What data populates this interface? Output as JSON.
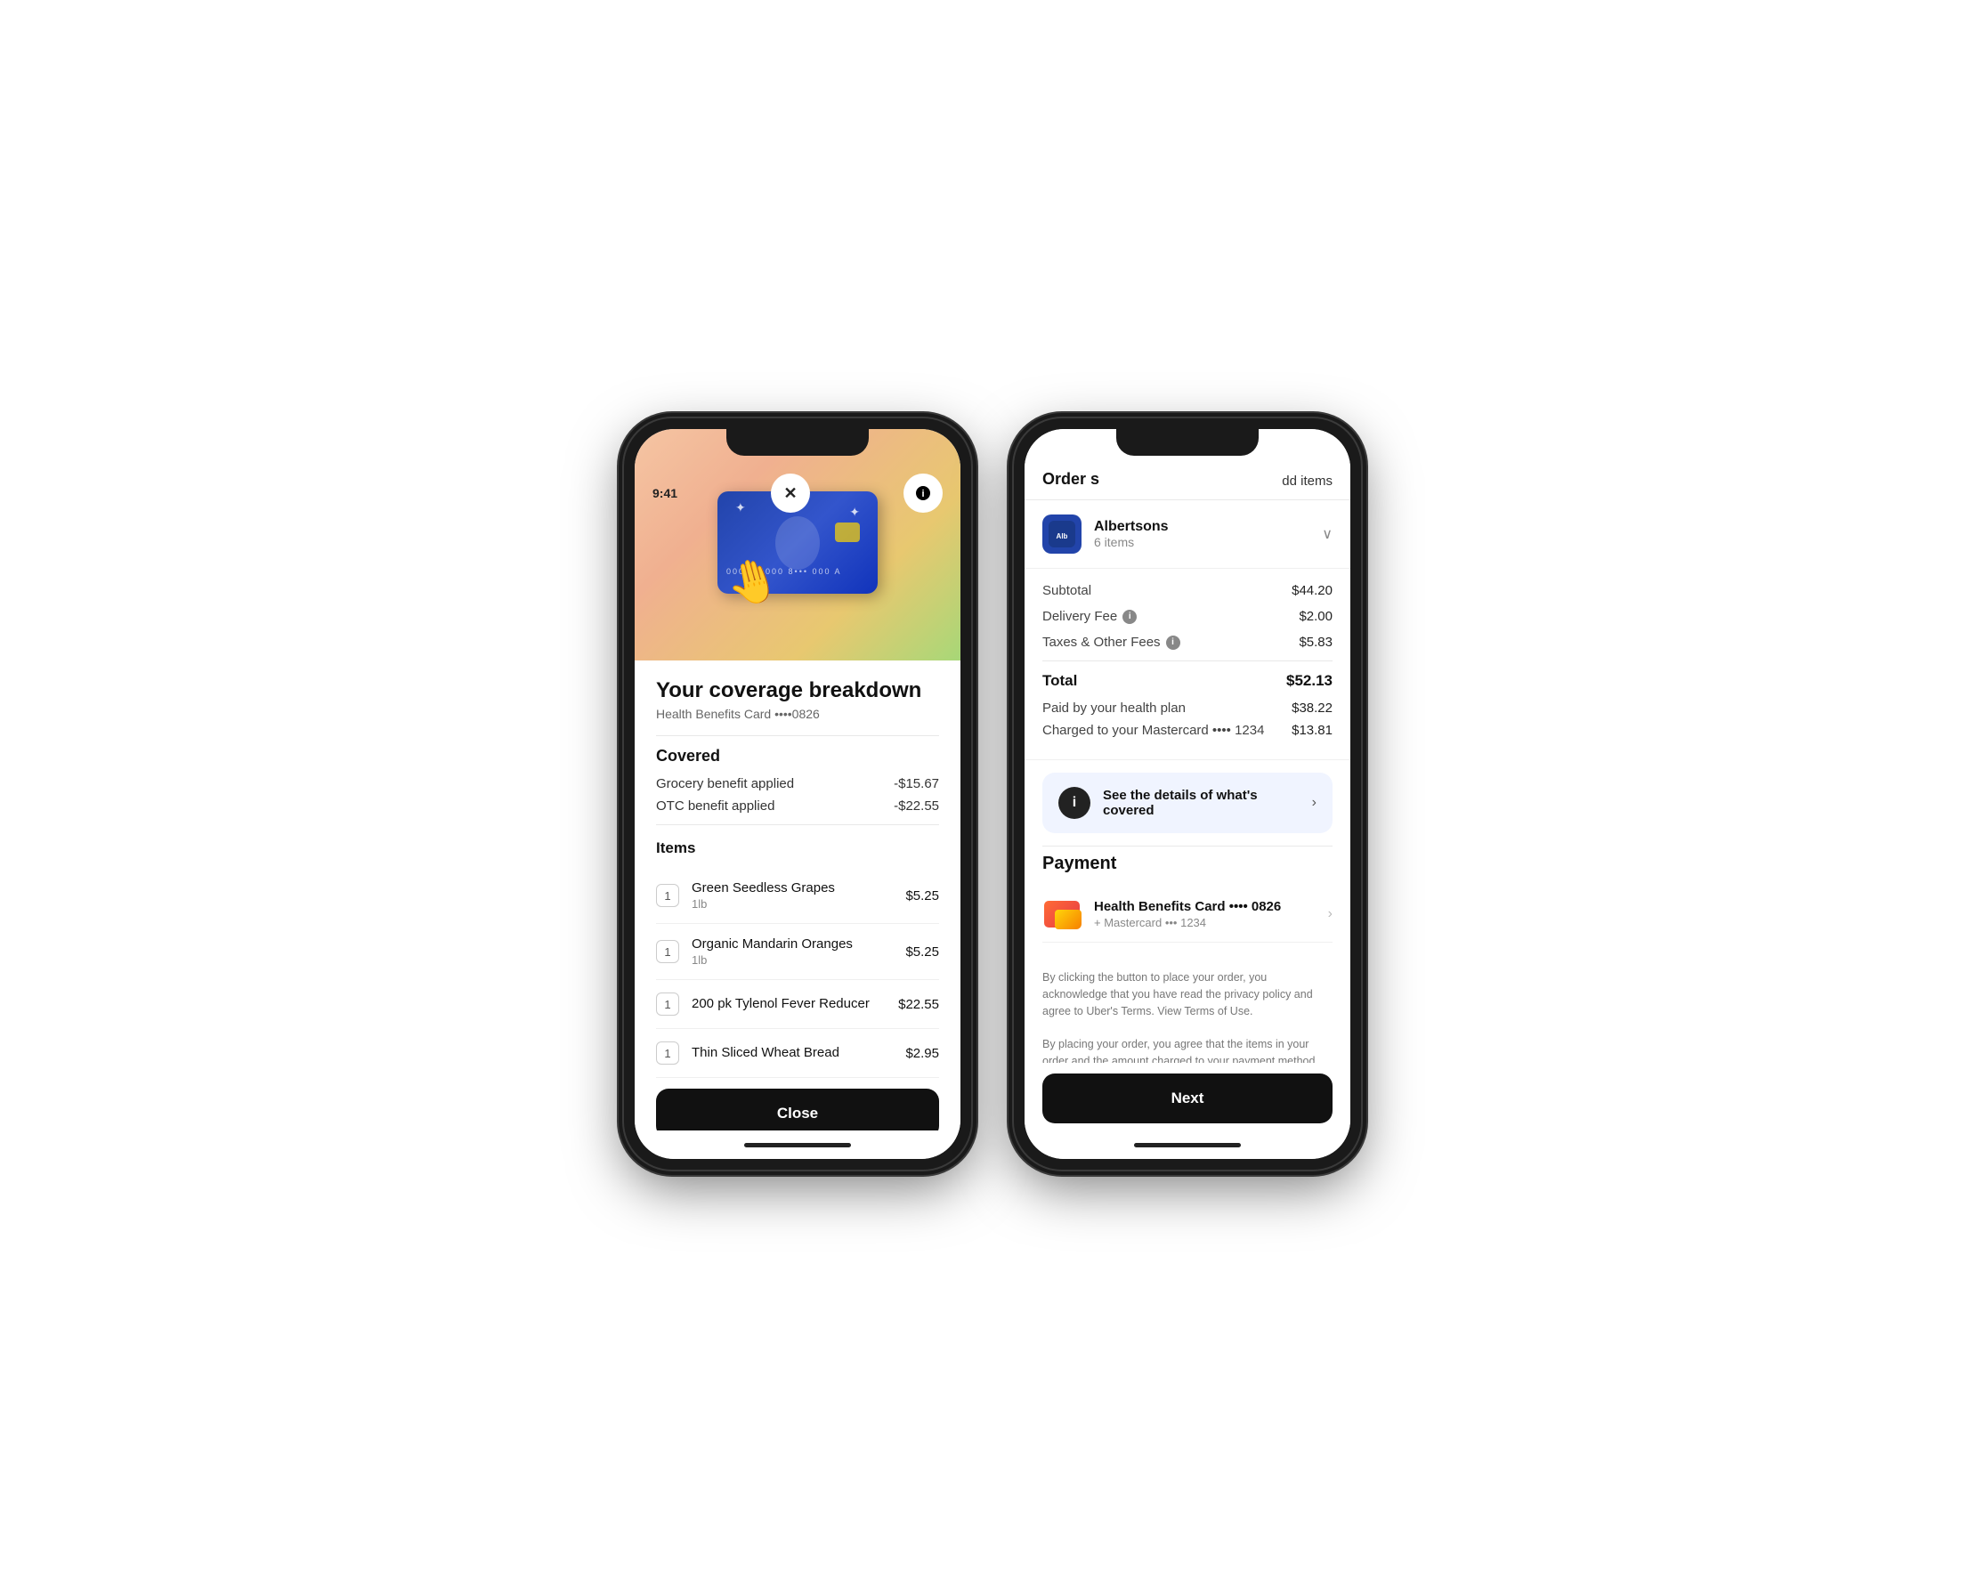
{
  "phone1": {
    "status_time": "9:41",
    "header": {
      "title": "Your coverage breakdown",
      "subtitle": "Health Benefits Card ••••0826"
    },
    "covered_section": {
      "title": "Covered",
      "benefits": [
        {
          "label": "Grocery benefit applied",
          "value": "-$15.67"
        },
        {
          "label": "OTC benefit applied",
          "value": "-$22.55"
        }
      ]
    },
    "items_section": {
      "title": "Items",
      "items": [
        {
          "qty": "1",
          "name": "Green Seedless Grapes",
          "detail": "1lb",
          "price": "$5.25"
        },
        {
          "qty": "1",
          "name": "Organic Mandarin Oranges",
          "detail": "1lb",
          "price": "$5.25"
        },
        {
          "qty": "1",
          "name": "200 pk Tylenol Fever Reducer",
          "detail": "",
          "price": "$22.55"
        },
        {
          "qty": "1",
          "name": "Thin Sliced Wheat Bread",
          "detail": "",
          "price": "$2.95"
        }
      ]
    },
    "close_button": "Close"
  },
  "phone2": {
    "nav": {
      "title": "Order s",
      "link": "dd items"
    },
    "merchant": {
      "name": "Albertsons",
      "items": "6 items"
    },
    "order": {
      "subtotal_label": "Subtotal",
      "subtotal_value": "$44.20",
      "delivery_label": "Delivery Fee",
      "delivery_value": "$2.00",
      "taxes_label": "Taxes & Other Fees",
      "taxes_value": "$5.83",
      "total_label": "Total",
      "total_value": "$52.13",
      "health_plan_label": "Paid by your health plan",
      "health_plan_value": "$38.22",
      "mastercard_label": "Charged to your Mastercard •••• 1234",
      "mastercard_value": "$13.81"
    },
    "covered_banner": {
      "text": "See the details of what's covered"
    },
    "payment": {
      "title": "Payment",
      "method_name": "Health Benefits Card •••• 0826",
      "method_sub": "+ Mastercard ••• 1234"
    },
    "legal": {
      "text1": "By clicking the button to place your order, you acknowledge that you have read the privacy policy and agree to Uber's Terms. View Terms of Use.",
      "text2": "By placing your order, you agree that the items in your order and the amount charged to your payment method are subject to change based on in-store item availability."
    },
    "next_button": "Next"
  }
}
